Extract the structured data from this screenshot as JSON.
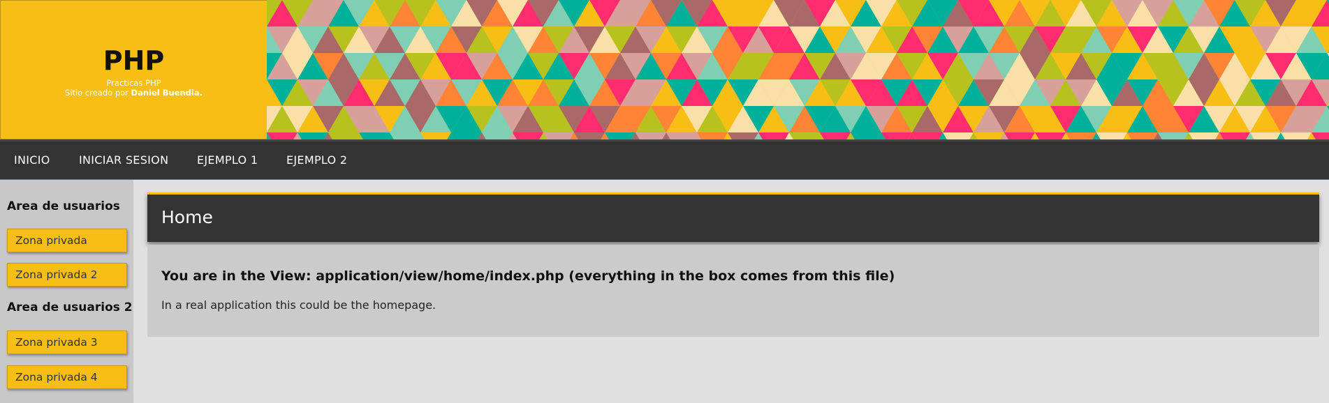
{
  "header": {
    "title": "PHP",
    "subtitle": "Practicas PHP",
    "credit_prefix": "Sitio creado por",
    "credit_name": "Daniel Buendia."
  },
  "nav": {
    "items": [
      "INICIO",
      "INICIAR SESION",
      "EJEMPLO 1",
      "EJEMPLO 2"
    ]
  },
  "sidebar": {
    "sections": [
      {
        "heading": "Area de usuarios",
        "links": [
          "Zona privada",
          "Zona privada 2"
        ]
      },
      {
        "heading": "Area de usuarios 2",
        "links": [
          "Zona privada 3",
          "Zona privada 4"
        ]
      }
    ]
  },
  "main": {
    "title": "Home",
    "heading": "You are in the View: application/view/home/index.php (everything in the box comes from this file)",
    "text": "In a real application this could be the homepage."
  },
  "colors": {
    "accent": "#f7be16",
    "nav_bg": "#333333",
    "sidebar_bg": "#c8c8c8",
    "content_bg": "#cbcbcb",
    "page_bg": "#e0e0e0",
    "pattern": [
      "#f7be16",
      "#ff2d6f",
      "#00b09b",
      "#b7c21e",
      "#f9e0a8",
      "#ff8436",
      "#d7a09a",
      "#a86968",
      "#7ecfb3"
    ]
  }
}
